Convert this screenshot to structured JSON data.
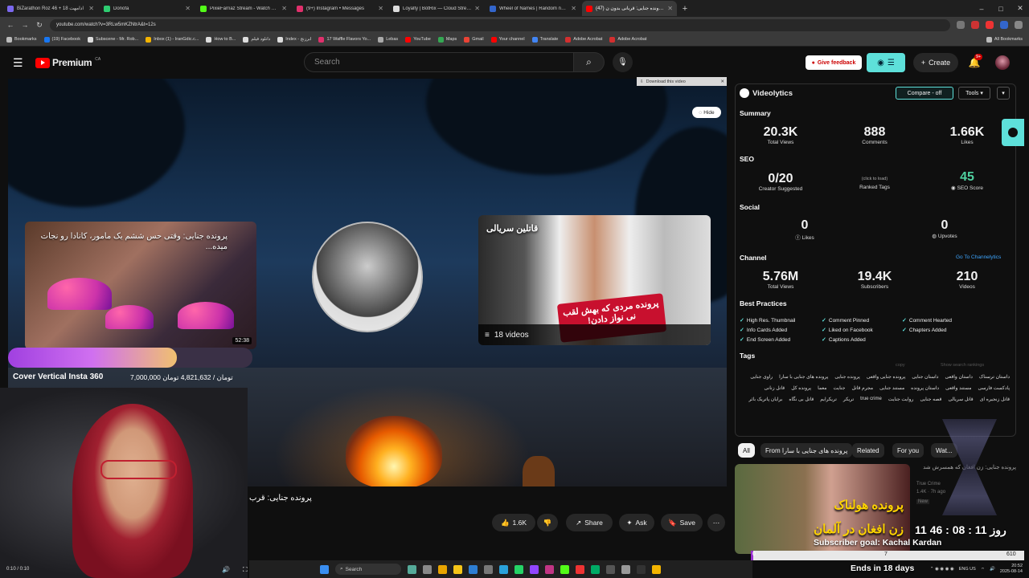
{
  "browser": {
    "tabs": [
      {
        "label": "BiZarathon Roz 46 + 18 ادامهت",
        "color": "#7b68ee"
      },
      {
        "label": "Donofa",
        "color": "#2ecc71"
      },
      {
        "label": "PixieFarnaz Stream - Watch Live",
        "color": "#53fc18"
      },
      {
        "label": "(9+) Instagram • Messages",
        "color": "#e1306c"
      },
      {
        "label": "Loyalty | BotRix — Cloud Stream",
        "color": "#ddd"
      },
      {
        "label": "Wheel of Names | Random name",
        "color": "#3366cc"
      },
      {
        "label": "(47) پرونده جنایی: قربانی بدون ن...",
        "color": "#ff0000",
        "active": true
      }
    ],
    "url": "youtube.com/watch?v=3RLw5mKZNtrA&t=12s",
    "bookmarks": [
      {
        "label": "Bookmarks",
        "color": "#bbb"
      },
      {
        "label": "(19) Facebook",
        "color": "#1877f2"
      },
      {
        "label": "Subscene - Mr. Rob...",
        "color": "#ddd"
      },
      {
        "label": "Inbox (1) - IranGdic.c...",
        "color": "#f4b400"
      },
      {
        "label": "How to B...",
        "color": "#ddd"
      },
      {
        "label": "دانلود فیلم",
        "color": "#ddd"
      },
      {
        "label": "Index - ابرزنج",
        "color": "#ddd"
      },
      {
        "label": "17 Waffle Flavors Yo...",
        "color": "#e1306c"
      },
      {
        "label": "Lebas",
        "color": "#aaa"
      },
      {
        "label": "YouTube",
        "color": "#ff0000"
      },
      {
        "label": "Maps",
        "color": "#34a853"
      },
      {
        "label": "Gmail",
        "color": "#ea4335"
      },
      {
        "label": "Your channel",
        "color": "#ff0000"
      },
      {
        "label": "Translate",
        "color": "#4285f4"
      },
      {
        "label": "Adobe Acrobat",
        "color": "#d32f2f"
      },
      {
        "label": "Adobe Acrobat",
        "color": "#d32f2f"
      }
    ],
    "all_bookmarks": "All Bookmarks"
  },
  "youtube": {
    "logo_text": "Premium",
    "logo_region": "CA",
    "search_placeholder": "Search",
    "feedback_label": "Give feedback",
    "create_label": "Create",
    "notif_badge": "9+"
  },
  "video": {
    "download_label": "Download this video",
    "hide_label": "Hide",
    "card1_title": "پرونده جنایی: وقتی حس ششم یک مامور، کانادا رو نجات میده...",
    "card1_duration": "52:38",
    "card2_title": "قاتلین سریالی",
    "card2_banner": "پرونده مردی که بهش لقب نی نواز دادن!",
    "card2_count": "18 videos",
    "caption": "پرونده جنایی: قرب",
    "timecode": "0:10 / 0:10"
  },
  "overlay": {
    "goal_name": "Cover Vertical Insta 360",
    "goal_amount": "7,000,000 تومان / 4,821,632 تومان",
    "goal_progress": 0.69,
    "countdown": "11 روز 11 : 08 : 46",
    "subgoal_title": "Subscriber goal: Kachal Kardan",
    "sub_current": "0",
    "sub_mid": "7",
    "sub_target": "610",
    "sub_progress": 0.01,
    "ends_label": "Ends in 18 days"
  },
  "actions": {
    "like": "1.6K",
    "share": "Share",
    "ask": "Ask",
    "save": "Save"
  },
  "videolytics": {
    "title": "Videolytics",
    "compare": "Compare - off",
    "tools": "Tools",
    "summary": "Summary",
    "total_views": "20.3K",
    "total_views_label": "Total Views",
    "comments": "888",
    "comments_label": "Comments",
    "likes": "1.66K",
    "likes_label": "Likes",
    "seo": "SEO",
    "creator_suggested": "0/20",
    "creator_suggested_label": "Creator Suggested",
    "ranked_tags_hint": "(click to load)",
    "ranked_tags_label": "Ranked Tags",
    "seo_score": "45",
    "seo_score_label": "SEO Score",
    "social": "Social",
    "social_likes": "0",
    "social_likes_label": "Likes",
    "upvotes": "0",
    "upvotes_label": "Upvotes",
    "channel": "Channel",
    "go_channel": "Go To Channelytics",
    "ch_views": "5.76M",
    "ch_views_label": "Total Views",
    "subscribers": "19.4K",
    "subscribers_label": "Subscribers",
    "videos": "210",
    "videos_label": "Videos",
    "best_practices": "Best Practices",
    "practices": [
      "High Res. Thumbnail",
      "Comment Pinned",
      "Comment Hearted",
      "Info Cards Added",
      "Liked on Facebook",
      "Chapters Added",
      "End Screen Added",
      "Captions Added"
    ],
    "tags_label": "Tags",
    "copy_label": "copy",
    "show_rankings": "Show search rankings",
    "tags": [
      "داستان ترسناک",
      "داستان واقعی",
      "داستان جنایی",
      "پرونده جنایی واقعی",
      "پرونده جنایی",
      "پرونده های جنایی با سارا",
      "راوی جنایی",
      "پادکست فارسی",
      "مستند واقعی",
      "داستان پرونده",
      "مستند جنایی",
      "مجرم قاتل",
      "جنایت",
      "معما",
      "پرونده کل",
      "قاتل زنانی",
      "قاتل زنجیره ای",
      "قاتل سریالی",
      "قصه جنایی",
      "روایت جنایت",
      "true crime",
      "تریکر",
      "تریکرایم",
      "قاتل بی نگاه",
      "برایان پاتریک بائر"
    ]
  },
  "related": {
    "chips": [
      "All",
      "From پرونده های جنایی با سارا",
      "Related",
      "For you",
      "Wat..."
    ],
    "thumb_line1": "پرونده هولناک",
    "thumb_line2": "زن افغان در آلمان",
    "title": "پرونده جنایی: زن افغان که همسرش شد",
    "channel": "True Crime",
    "meta": "1.4K · 7h ago",
    "badge": "New"
  },
  "taskbar": {
    "search": "Search",
    "lang": "ENG US",
    "time": "20:52",
    "date": "2025-08-14"
  }
}
